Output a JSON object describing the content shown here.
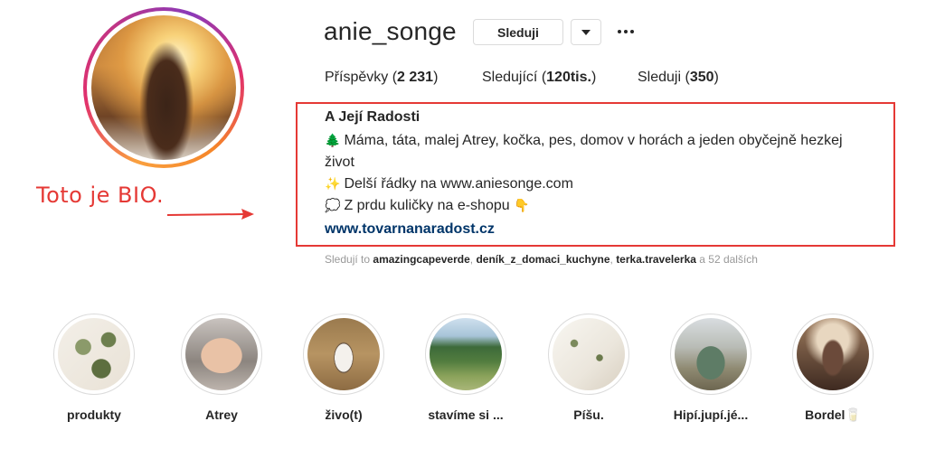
{
  "profile": {
    "username": "anie_songe",
    "follow_label": "Sleduji",
    "stats": {
      "posts_label": "Příspěvky",
      "posts_count": "2 231",
      "followers_label": "Sledující",
      "followers_count": "120tis.",
      "following_label": "Sleduji",
      "following_count": "350"
    }
  },
  "bio": {
    "name": "A Její Radosti",
    "line1_emoji": "🌲",
    "line1_a": "Máma, táta, malej Atrey, kočka, pes, domov v horách a jeden obyčejně hezkej",
    "line1_b": "život",
    "line2_emoji": "✨",
    "line2": "Delší řádky na www.aniesonge.com",
    "line3_emoji": "💭",
    "line3": "Z prdu kuličky na e-shopu",
    "line3_end_emoji": "👇",
    "link": "www.tovarnanaradost.cz"
  },
  "followed_by": {
    "prefix": "Sledují to",
    "user1": "amazingcapeverde",
    "user2": "deník_z_domaci_kuchyne",
    "user3": "terka.travelerka",
    "suffix": "a 52 dalších"
  },
  "annotation": {
    "text": "Toto je BIO.",
    "color": "#e53935"
  },
  "highlights": [
    {
      "label": "produkty"
    },
    {
      "label": "Atrey"
    },
    {
      "label": "živo(t)"
    },
    {
      "label": "stavíme si ..."
    },
    {
      "label": "Píšu."
    },
    {
      "label": "Hipí.jupí.jé..."
    },
    {
      "label": "Bordel🥛"
    }
  ],
  "icons": {
    "dropdown": "chevron-down-icon",
    "more": "more-options-icon"
  }
}
